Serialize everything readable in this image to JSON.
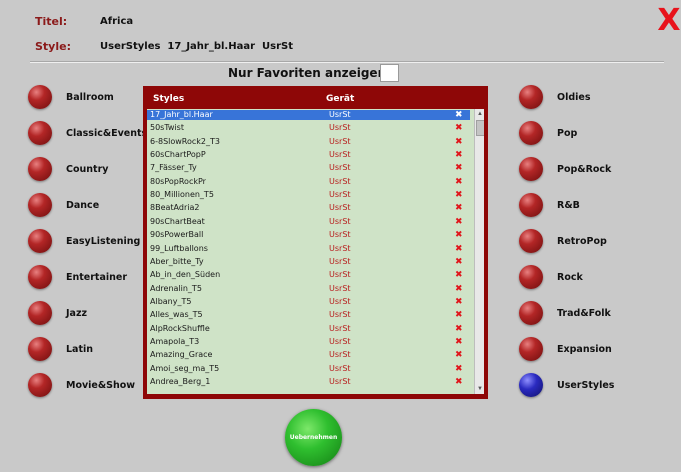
{
  "header": {
    "title_label": "Titel:",
    "title_value": "Africa",
    "style_label": "Style:",
    "style_value": "UserStyles  17_Jahr_bl.Haar  UsrSt",
    "close": "X"
  },
  "favorites": {
    "label": "Nur Favoriten anzeigen",
    "checked": false
  },
  "categories_left": [
    {
      "label": "Ballroom"
    },
    {
      "label": "Classic&Events"
    },
    {
      "label": "Country"
    },
    {
      "label": "Dance"
    },
    {
      "label": "EasyListening"
    },
    {
      "label": "Entertainer"
    },
    {
      "label": "Jazz"
    },
    {
      "label": "Latin"
    },
    {
      "label": "Movie&Show"
    }
  ],
  "categories_right": [
    {
      "label": "Oldies"
    },
    {
      "label": "Pop"
    },
    {
      "label": "Pop&Rock"
    },
    {
      "label": "R&B"
    },
    {
      "label": "RetroPop"
    },
    {
      "label": "Rock"
    },
    {
      "label": "Trad&Folk"
    },
    {
      "label": "Expansion"
    },
    {
      "label": "UserStyles"
    }
  ],
  "list": {
    "col_styles": "Styles",
    "col_device": "Gerät",
    "delete_glyph": "✖",
    "rows": [
      {
        "name": "17_Jahr_bl.Haar",
        "device": "UsrSt"
      },
      {
        "name": "50sTwist",
        "device": "UsrSt"
      },
      {
        "name": "6-8SlowRock2_T3",
        "device": "UsrSt"
      },
      {
        "name": "60sChartPopP",
        "device": "UsrSt"
      },
      {
        "name": "7_Fässer_Ty",
        "device": "UsrSt"
      },
      {
        "name": "80sPopRockPr",
        "device": "UsrSt"
      },
      {
        "name": "80_Millionen_T5",
        "device": "UsrSt"
      },
      {
        "name": "8BeatAdria2",
        "device": "UsrSt"
      },
      {
        "name": "90sChartBeat",
        "device": "UsrSt"
      },
      {
        "name": "90sPowerBall",
        "device": "UsrSt"
      },
      {
        "name": "99_Luftballons",
        "device": "UsrSt"
      },
      {
        "name": "Aber_bitte_Ty",
        "device": "UsrSt"
      },
      {
        "name": "Ab_in_den_Süden",
        "device": "UsrSt"
      },
      {
        "name": "Adrenalin_T5",
        "device": "UsrSt"
      },
      {
        "name": "Albany_T5",
        "device": "UsrSt"
      },
      {
        "name": "Alles_was_T5",
        "device": "UsrSt"
      },
      {
        "name": "AlpRockShuffle",
        "device": "UsrSt"
      },
      {
        "name": "Amapola_T3",
        "device": "UsrSt"
      },
      {
        "name": "Amazing_Grace",
        "device": "UsrSt"
      },
      {
        "name": "Amoi_seg_ma_T5",
        "device": "UsrSt"
      },
      {
        "name": "Andrea_Berg_1",
        "device": "UsrSt"
      }
    ]
  },
  "apply_button": "Uebernehmen"
}
